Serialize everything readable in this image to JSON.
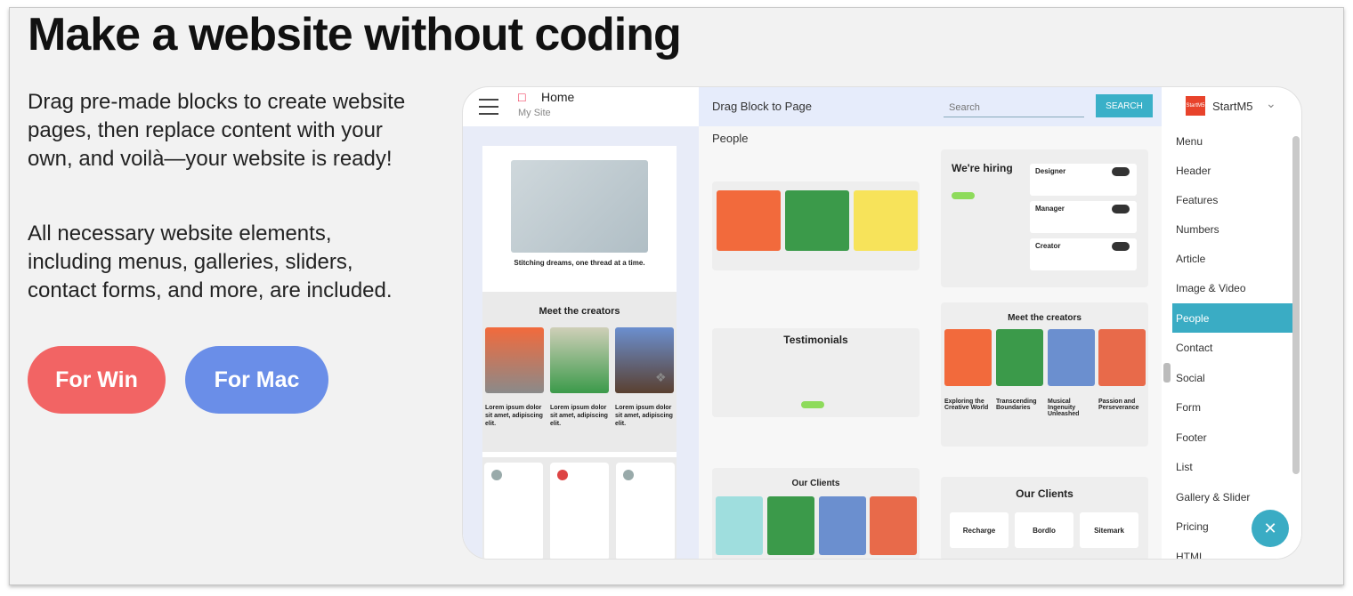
{
  "headline": "Make a website without coding",
  "intro": "Drag pre-made blocks to create website pages, then replace content with your own, and voilà—your website is ready!",
  "features_text": "All necessary website elements, including menus, galleries, sliders, contact forms, and more, are included.",
  "buttons": {
    "win": "For Win",
    "mac": "For Mac"
  },
  "colors": {
    "win": "#f26464",
    "mac": "#6a8ee8",
    "accent": "#3aacc4"
  },
  "app": {
    "page_title": "Home",
    "site_name": "My Site",
    "drag_label": "Drag Block to Page",
    "search_placeholder": "Search",
    "search_button": "SEARCH",
    "theme_name": "StartM5",
    "theme_logo": "StartM5",
    "section_label": "People",
    "preview": {
      "hero_caption": "Stitching dreams, one thread at a time.",
      "section_title": "Meet the creators",
      "captions": [
        "Lorem ipsum dolor sit amet, adipiscing elit.",
        "Lorem ipsum dolor sit amet, adipiscing elit.",
        "Lorem ipsum dolor sit amet, adipiscing elit."
      ]
    },
    "blocks": {
      "hiring_title": "We're hiring",
      "jobs": [
        "Designer",
        "Manager",
        "Creator"
      ],
      "creators_title": "Meet the creators",
      "creator_captions": [
        "Exploring the Creative World",
        "Transcending Boundaries",
        "Musical Ingenuity Unleashed",
        "Passion and Perseverance"
      ],
      "testimonials_title": "Testimonials",
      "clients_title": "Our Clients",
      "clients_title_2": "Our Clients",
      "client_logos": [
        "Recharge",
        "Bordlo",
        "Sitemark"
      ]
    },
    "categories": [
      "Menu",
      "Header",
      "Features",
      "Numbers",
      "Article",
      "Image & Video",
      "People",
      "Contact",
      "Social",
      "Form",
      "Footer",
      "List",
      "Gallery & Slider",
      "Pricing",
      "HTML"
    ],
    "active_category": "People"
  }
}
